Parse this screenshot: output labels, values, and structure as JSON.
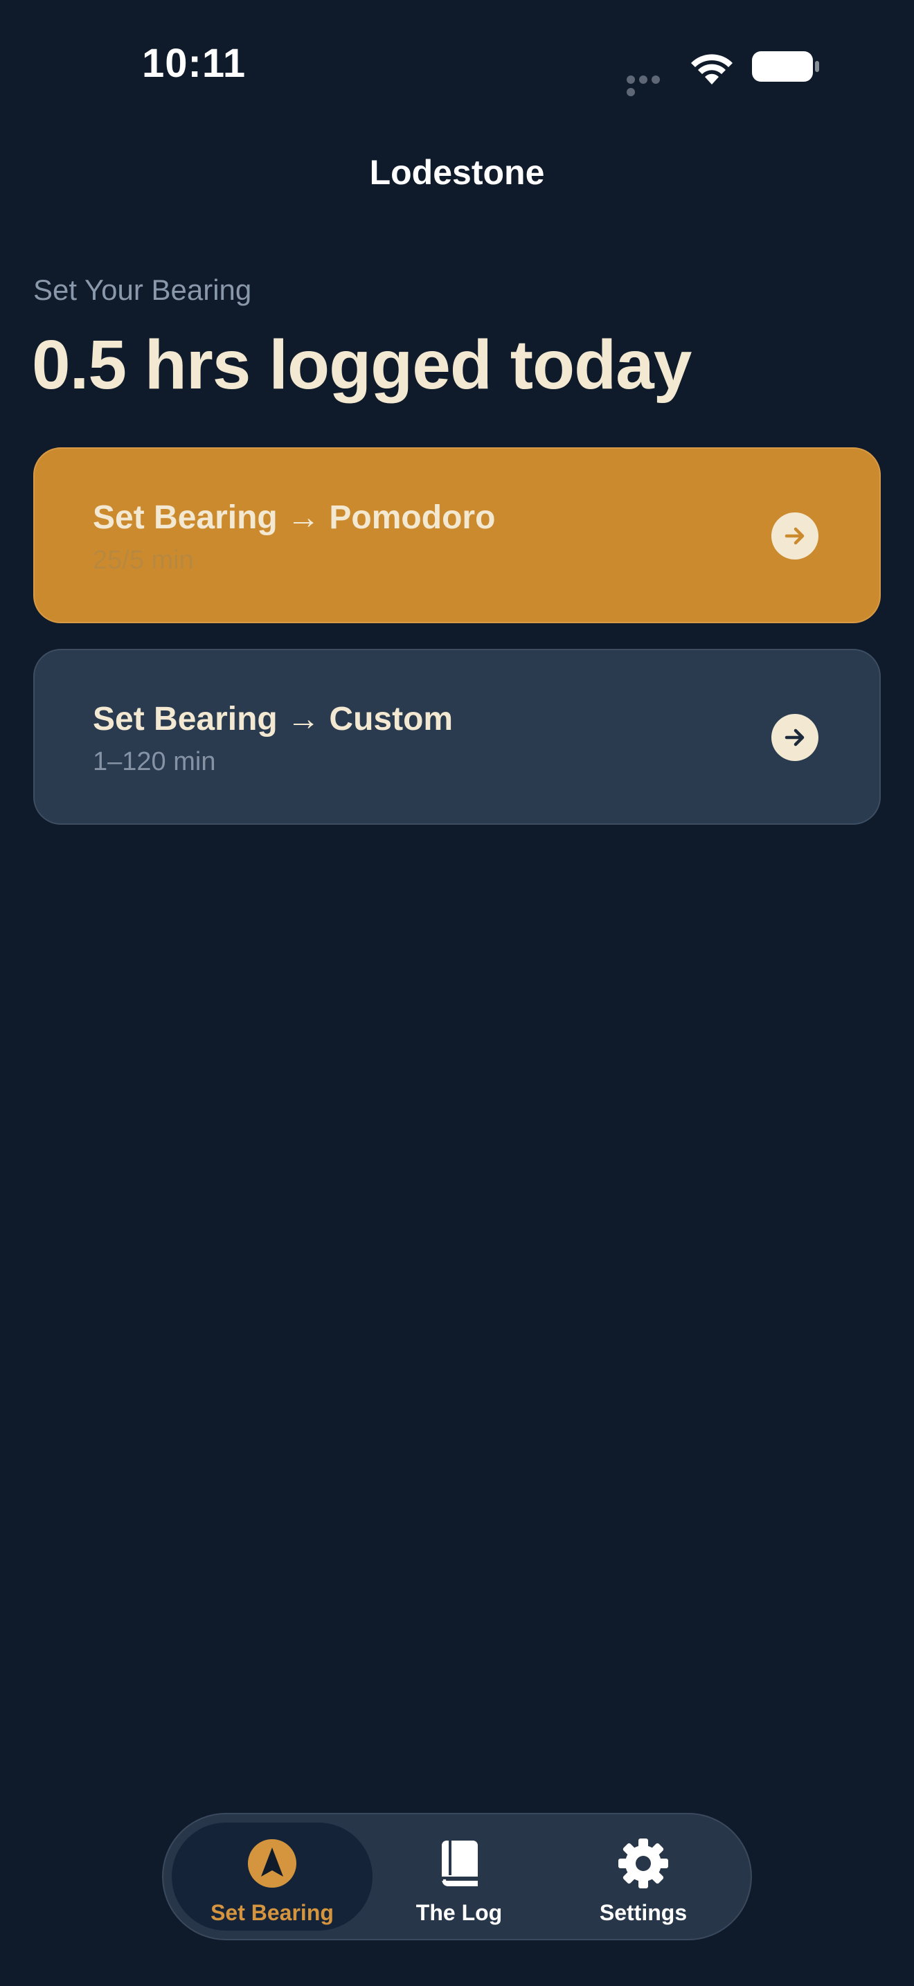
{
  "status_bar": {
    "time": "10:11"
  },
  "nav": {
    "title": "Lodestone"
  },
  "header": {
    "section_label": "Set Your Bearing",
    "headline": "0.5 hrs logged today"
  },
  "cards": [
    {
      "title": "Set Bearing → Pomodoro",
      "subtitle": "25/5 min",
      "icon": "arrow-right-icon"
    },
    {
      "title": "Set Bearing → Custom",
      "subtitle": "1–120 min",
      "icon": "arrow-right-icon"
    }
  ],
  "tab_bar": {
    "tabs": [
      {
        "label": "Set Bearing",
        "icon": "compass-navigation-icon",
        "active": true
      },
      {
        "label": "The Log",
        "icon": "book-icon",
        "active": false
      },
      {
        "label": "Settings",
        "icon": "gear-icon",
        "active": false
      }
    ]
  },
  "colors": {
    "background": "#0f1a2a",
    "accent": "#cc8a2f",
    "card_secondary": "#2a3a4f",
    "text_primary": "#f3e9d2",
    "text_muted": "#8a98ab",
    "tab_active": "#d4953e"
  }
}
